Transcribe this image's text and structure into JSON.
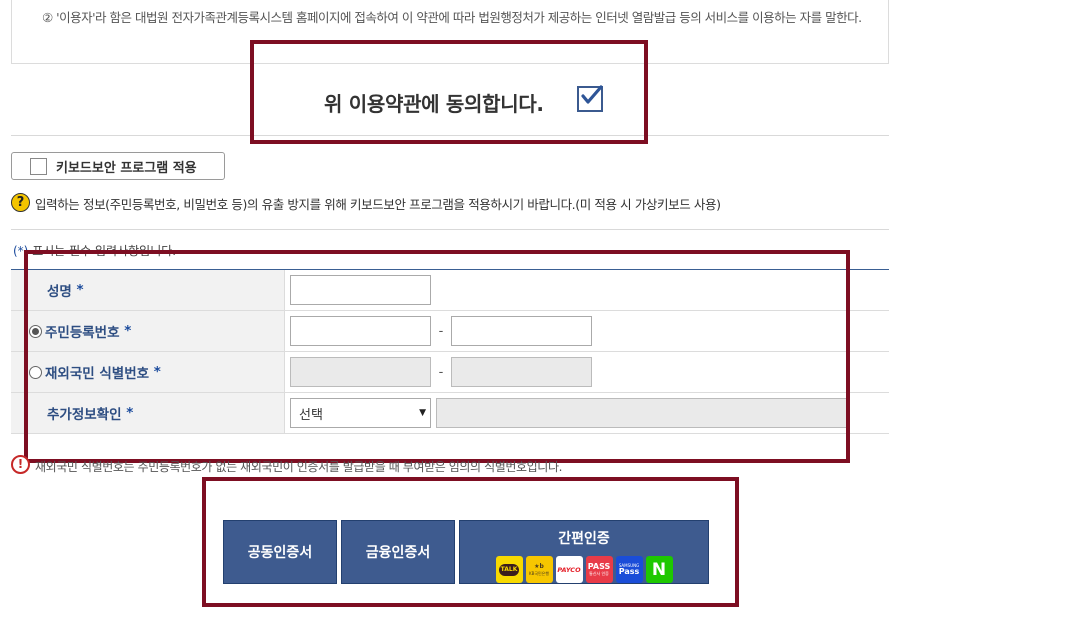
{
  "terms": {
    "text": "② '이용자'라 함은 대법원 전자가족관계등록시스템 홈페이지에 접속하여 이 약관에 따라 법원행정처가 제공하는 인터넷 열람발급 등의 서비스를 이용하는 자를 말한다."
  },
  "agree": {
    "label": "위 이용약관에 동의합니다.",
    "checked": true,
    "check_mark": "✔"
  },
  "keyboard_security": {
    "label": "키보드보안 프로그램 적용",
    "checked": false
  },
  "help": {
    "icon": "?",
    "text": "입력하는 정보(주민등록번호, 비밀번호 등)의 유출 방지를 위해 키보드보안 프로그램을 적용하시기 바랍니다.(미 적용 시 가상키보드 사용)"
  },
  "required_note": {
    "star": "(*)",
    "text": " 표시는 필수 입력사항입니다."
  },
  "form": {
    "name_label": "성명",
    "resident_label": "주민등록번호",
    "foreign_label": "재외국민 식별번호",
    "extra_label": "추가정보확인",
    "star": "*",
    "dash": "-",
    "name_value": "",
    "resident_first": "",
    "resident_second": "",
    "foreign_first": "",
    "foreign_second": "",
    "select_value": "선택",
    "select_arrow": "▼",
    "resident_selected": true,
    "foreign_selected": false
  },
  "warning": {
    "icon": "!",
    "text": "재외국민 식별번호는 주민등록번호가 없는 재외국민이 인증서를 발급받을 때 부여받은 임의의 식별번호입니다."
  },
  "auth": {
    "public_cert": "공동인증서",
    "financial_cert": "금융인증서",
    "easy_auth": "간편인증",
    "logos": {
      "kakao": "TALK",
      "kb": "★b",
      "kb_sub": "KB국민은행",
      "payco": "PAYCO",
      "pass": "PASS",
      "pass_sub": "통신사 인증",
      "samsung": "Pass",
      "samsung_sub": "SAMSUNG",
      "naver": "N"
    }
  },
  "colors": {
    "highlight_border": "#7d0e22",
    "button_blue": "#3e5b8f",
    "label_blue": "#2e4e82"
  }
}
